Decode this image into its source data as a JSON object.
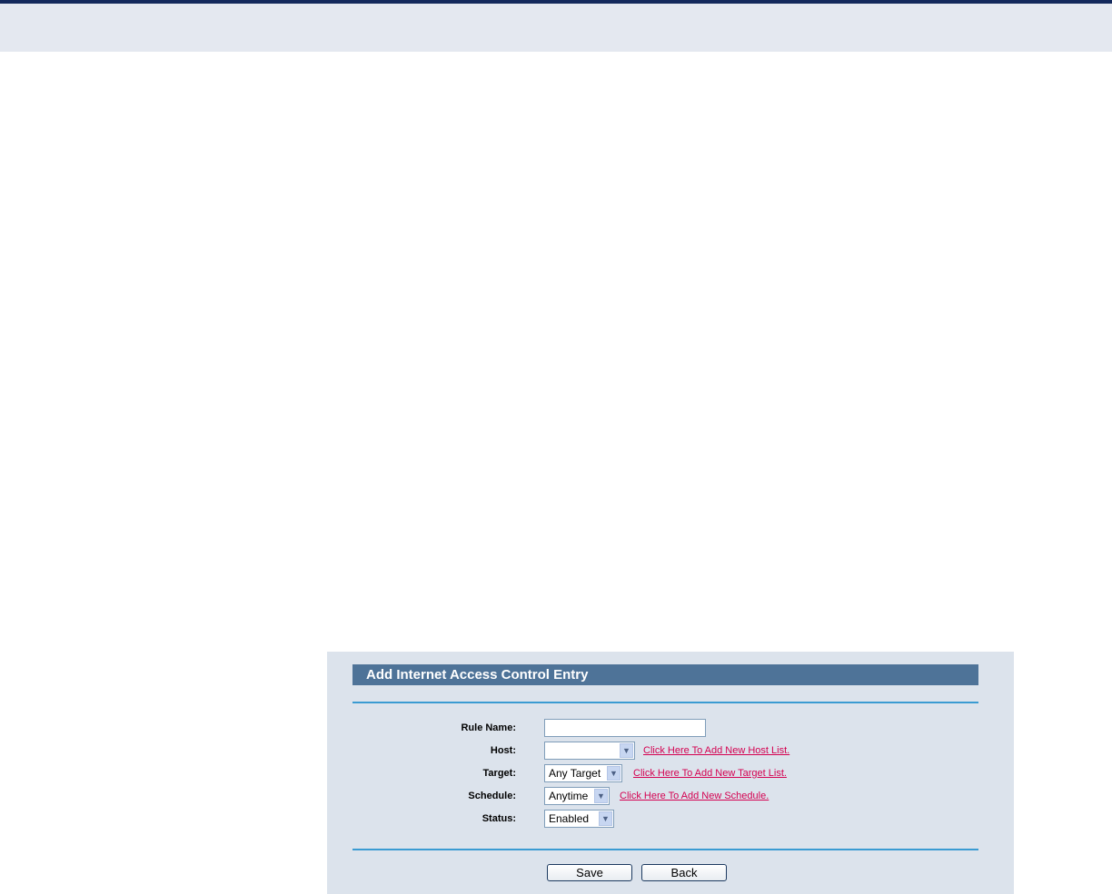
{
  "form": {
    "title": "Add Internet Access Control Entry",
    "rule_name": {
      "label": "Rule Name:",
      "value": ""
    },
    "host": {
      "label": "Host:",
      "selected": "",
      "link": "Click Here To Add New Host List."
    },
    "target": {
      "label": "Target:",
      "selected": "Any Target",
      "link": "Click Here To Add New Target List."
    },
    "schedule": {
      "label": "Schedule:",
      "selected": "Anytime",
      "link": "Click Here To Add New Schedule."
    },
    "status": {
      "label": "Status:",
      "selected": "Enabled"
    },
    "save_label": "Save",
    "back_label": "Back"
  },
  "colors": {
    "title_bar": "#4e7398",
    "panel_bg": "#dce3ec",
    "rule_line": "#3a9bd2",
    "link": "#d40050",
    "top_line": "#13295c"
  },
  "icons": {
    "dropdown": "chevron-down-icon"
  }
}
